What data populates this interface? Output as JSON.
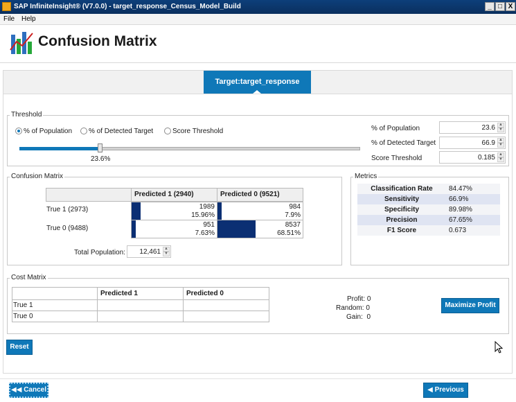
{
  "window": {
    "title": "SAP InfiniteInsight® (V7.0.0) - target_response_Census_Model_Build",
    "controls": [
      "_",
      "□",
      "X"
    ]
  },
  "menu": {
    "file": "File",
    "help": "Help"
  },
  "page": {
    "title": "Confusion Matrix"
  },
  "target_tab": {
    "label": "Target:target_response"
  },
  "threshold": {
    "group_label": "Threshold",
    "options": [
      "% of Population",
      "% of Detected Target",
      "Score Threshold"
    ],
    "selected": "% of Population",
    "slider_value_label": "23.6%",
    "slider_fraction": 0.236,
    "fields": [
      {
        "label": "% of Population",
        "value": "23.6"
      },
      {
        "label": "% of Detected Target",
        "value": "66.9"
      },
      {
        "label": "Score Threshold",
        "value": "0.185"
      }
    ]
  },
  "confusion": {
    "group_label": "Confusion Matrix",
    "col_headers": [
      "Predicted 1  (2940)",
      "Predicted 0  (9521)"
    ],
    "rows": [
      {
        "label": "True 1  (2973)",
        "cells": [
          {
            "count": "1989",
            "pct": "15.96%",
            "fraction": 0.1596
          },
          {
            "count": "984",
            "pct": "7.9%",
            "fraction": 0.079
          }
        ]
      },
      {
        "label": "True 0  (9488)",
        "cells": [
          {
            "count": "951",
            "pct": "7.63%",
            "fraction": 0.0763
          },
          {
            "count": "8537",
            "pct": "68.51%",
            "fraction": 0.6851
          }
        ]
      }
    ],
    "total_label": "Total Population:",
    "total_value": "12,461"
  },
  "metrics": {
    "group_label": "Metrics",
    "rows": [
      {
        "name": "Classification Rate",
        "value": "84.47%"
      },
      {
        "name": "Sensitivity",
        "value": "66.9%"
      },
      {
        "name": "Specificity",
        "value": "89.98%"
      },
      {
        "name": "Precision",
        "value": "67.65%"
      },
      {
        "name": "F1 Score",
        "value": "0.673"
      }
    ]
  },
  "cost": {
    "group_label": "Cost Matrix",
    "col_headers": [
      "Predicted 1",
      "Predicted 0"
    ],
    "rows": [
      "True 1",
      "True 0"
    ],
    "profit": "Profit: 0",
    "random": "Random: 0",
    "gain": "Gain:  0",
    "maximize_label": "Maximize Profit"
  },
  "buttons": {
    "reset": "Reset",
    "cancel": "Cancel",
    "previous": "Previous"
  },
  "colors": {
    "accent": "#0f78b8",
    "bar": "#0b2f73",
    "titlebar": "#0d3f7a",
    "metric_stripe": "#dfe4f2"
  }
}
